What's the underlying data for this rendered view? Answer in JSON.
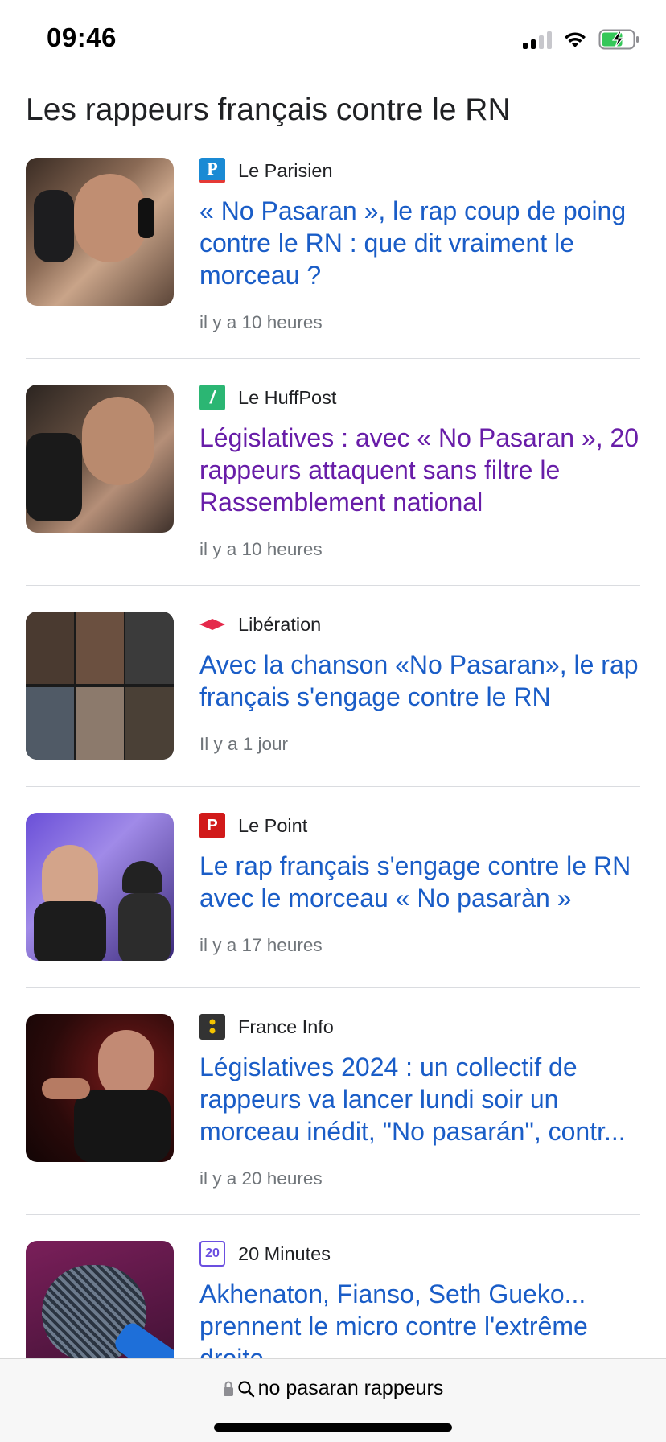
{
  "status_bar": {
    "time": "09:46"
  },
  "page_title": "Les rappeurs français contre le RN",
  "articles": [
    {
      "source": "Le Parisien",
      "logo": "le-parisien-logo",
      "headline": "« No Pasaran », le rap coup de poing contre le RN : que dit vraiment le morceau ?",
      "time": "il y a 10 heures",
      "visited": false
    },
    {
      "source": "Le HuffPost",
      "logo": "huffpost-logo",
      "headline": "Législatives : avec « No Pasaran », 20 rappeurs attaquent sans filtre le Rassemblement national",
      "time": "il y a 10 heures",
      "visited": true
    },
    {
      "source": "Libération",
      "logo": "liberation-logo",
      "headline": "Avec la chanson «No Pasaran», le rap français s'engage contre le RN",
      "time": "Il y a 1 jour",
      "visited": false
    },
    {
      "source": "Le Point",
      "logo": "le-point-logo",
      "headline": "Le rap français s'engage contre le RN avec le morceau « No pasaràn »",
      "time": "il y a 17 heures",
      "visited": false
    },
    {
      "source": "France Info",
      "logo": "france-info-logo",
      "headline": "Législatives 2024 : un collectif de rappeurs va lancer lundi soir un morceau inédit, \"No pasarán\", contr...",
      "time": "il y a 20 heures",
      "visited": false
    },
    {
      "source": "20 Minutes",
      "logo": "20-minutes-logo",
      "headline": "Akhenaton, Fianso, Seth Gueko... prennent le micro contre l'extrême droite",
      "time": "",
      "visited": false
    }
  ],
  "browser": {
    "url_text": "no pasaran rappeurs"
  },
  "colors": {
    "link": "#1a5dc7",
    "visited": "#681da8",
    "meta": "#70757a",
    "divider": "#dadce0"
  }
}
